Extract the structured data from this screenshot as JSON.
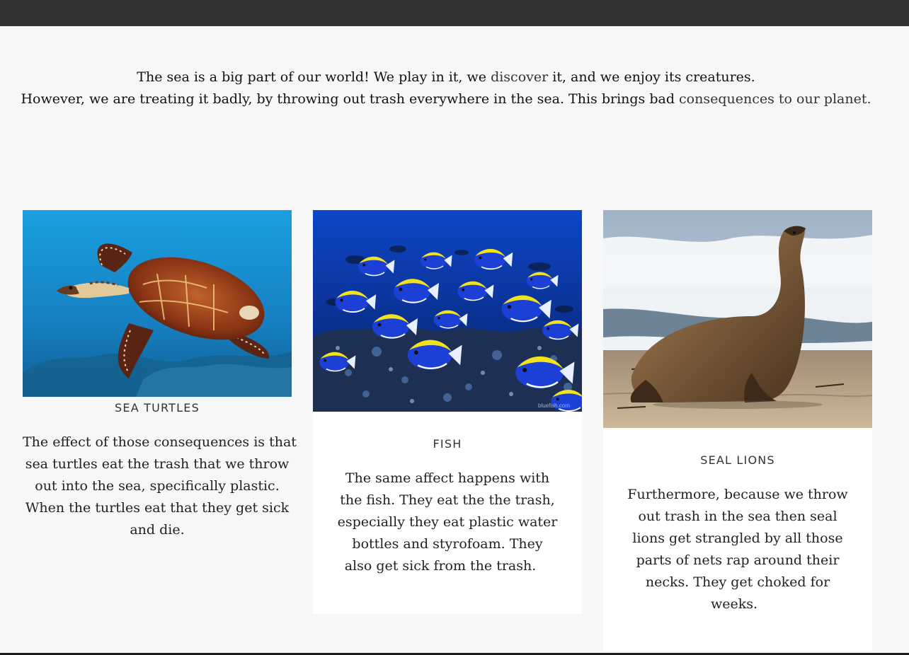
{
  "intro": {
    "line1": {
      "a": "The sea is a big part of our world! We play in it, we ",
      "b": "discover",
      "c": " it, and we enjoy its creatures."
    },
    "line2": {
      "a": "However, we are treating it badly, by throwing out trash everywhere in the sea. This brings bad ",
      "b": "consequences to our planet."
    }
  },
  "cards": [
    {
      "title": "SEA TURTLES",
      "image_alt": "Sea turtle swimming",
      "lines": [
        "The effect of those consequences is that",
        "sea turtles eat the trash that we throw",
        "out into the sea, specifically plastic.",
        "When the turtles eat that they get sick",
        "and die."
      ]
    },
    {
      "title": "FISH",
      "image_alt": "School of blue fish over coral",
      "watermark": "bluefish.com",
      "lines": [
        "The same affect happens with",
        "the fish. They eat the the trash,",
        "especially they eat plastic water",
        "bottles and  styrofoam. They",
        "also get sick from the trash."
      ]
    },
    {
      "title": "SEAL LIONS",
      "image_alt": "Sea lion on a beach",
      "lines": [
        "Furthermore, because we throw",
        "out trash in the sea then seal",
        "lions get strangled by all those",
        "parts of nets rap around their",
        "necks. They get choked for",
        "weeks."
      ]
    }
  ],
  "colors": {
    "topbar": "#333333",
    "page_bg": "#f7f7f7",
    "card_bg": "#ffffff",
    "text": "#222222"
  }
}
